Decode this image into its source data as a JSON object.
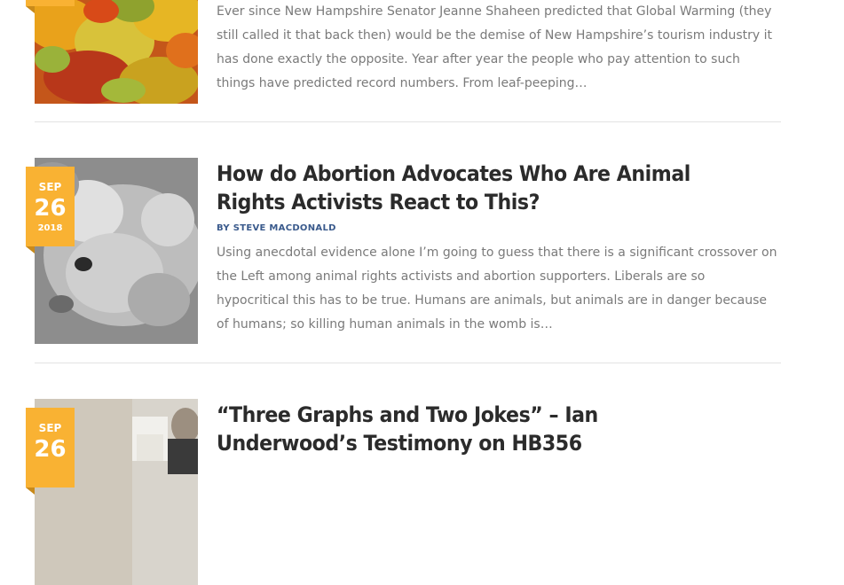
{
  "posts": [
    {
      "excerpt": "Ever since New Hampshire Senator Jeanne Shaheen predicted that Global Warming (they still called it that back then) would be the demise of New Hampshire’s tourism industry it has done exactly the opposite. Year after year the people who pay attention to such things have predicted record numbers. From leaf-peeping…",
      "image_icon": "autumn-leaves-image"
    },
    {
      "month": "SEP",
      "day": "26",
      "year": "2018",
      "title": "How do Abortion Advocates Who Are Animal Rights Activists React to This?",
      "byline": "BY STEVE MACDONALD",
      "excerpt": "Using anecdotal evidence alone I’m going to guess that there is a significant crossover on the Left among animal rights activists and abortion supporters. Liberals are so hypocritical this has to be true. Humans are animals, but animals are in danger because of humans; so killing human animals in the womb is…",
      "image_icon": "mouse-image"
    },
    {
      "month": "SEP",
      "day": "26",
      "title": "“Three Graphs and Two Jokes” – Ian Underwood’s Testimony on HB356",
      "image_icon": "testimony-photo"
    }
  ],
  "colors": {
    "accent": "#f9b233",
    "byline": "#3a5a8c",
    "title": "#2b2b2b",
    "excerpt": "#7a7a7a"
  }
}
